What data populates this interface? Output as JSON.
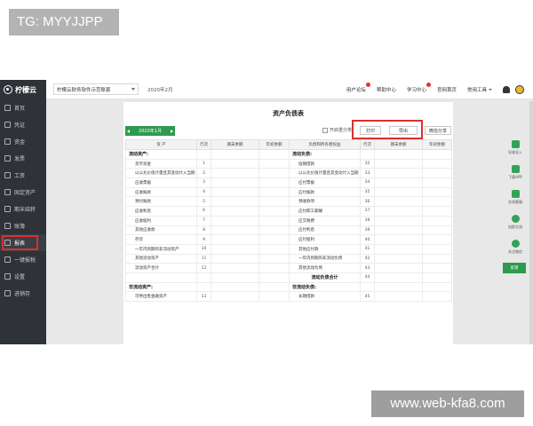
{
  "watermark": {
    "tag": "TG: MYYJJPP",
    "url": "www.web-kfa8.com"
  },
  "app": {
    "logo_text": "柠檬云",
    "sidebar": [
      {
        "label": "首页",
        "icon": "home-icon"
      },
      {
        "label": "凭证",
        "icon": "voucher-icon"
      },
      {
        "label": "资金",
        "icon": "fund-icon"
      },
      {
        "label": "发票",
        "icon": "invoice-icon"
      },
      {
        "label": "工资",
        "icon": "salary-icon"
      },
      {
        "label": "固定资产",
        "icon": "asset-icon"
      },
      {
        "label": "期末结转",
        "icon": "period-close-icon"
      },
      {
        "label": "账簿",
        "icon": "ledger-icon"
      },
      {
        "label": "报表",
        "icon": "report-icon",
        "active": true
      },
      {
        "label": "一键报税",
        "icon": "tax-icon"
      },
      {
        "label": "设置",
        "icon": "settings-icon"
      },
      {
        "label": "进销存",
        "icon": "inventory-icon"
      }
    ],
    "topbar": {
      "company": "柠檬云财务软件示范账套",
      "period": "2020年2月",
      "links": [
        {
          "label": "用户论坛",
          "badge": true
        },
        {
          "label": "帮助中心",
          "badge": false
        },
        {
          "label": "学习中心",
          "badge": true
        },
        {
          "label": "官网首页",
          "badge": false
        },
        {
          "label": "常用工具",
          "badge": false,
          "caret": true
        }
      ]
    },
    "sheet": {
      "title": "资产负债表",
      "period_picker": "2020年1月",
      "reclass_label": "开启重分类",
      "buttons": {
        "print": "打印",
        "export": "导出",
        "wechat": "微信分享"
      },
      "headers": [
        "资 产",
        "行次",
        "期末余额",
        "年初余额",
        "负债和所有者权益",
        "行次",
        "期末余额",
        "年初余额"
      ],
      "rows": [
        {
          "l": "流动资产:",
          "ln": "",
          "lt": "sec",
          "r": "流动负债:",
          "rn": "",
          "rt": "sec"
        },
        {
          "l": "货币资金",
          "ln": "1",
          "lt": "item",
          "r": "短期借款",
          "rn": "32",
          "rt": "item"
        },
        {
          "l": "以公允价值计量且其变动计入当期",
          "ln": "2",
          "lt": "item",
          "r": "以公允价值计量且其变动计入当期",
          "rn": "33",
          "rt": "item"
        },
        {
          "l": "应收票据",
          "ln": "3",
          "lt": "item",
          "r": "应付票据",
          "rn": "34",
          "rt": "item"
        },
        {
          "l": "应收账款",
          "ln": "4",
          "lt": "item",
          "r": "应付账款",
          "rn": "35",
          "rt": "item"
        },
        {
          "l": "预付账款",
          "ln": "5",
          "lt": "item",
          "r": "预收款项",
          "rn": "36",
          "rt": "item"
        },
        {
          "l": "应收利息",
          "ln": "6",
          "lt": "item",
          "r": "应付职工薪酬",
          "rn": "37",
          "rt": "item"
        },
        {
          "l": "应收股利",
          "ln": "7",
          "lt": "item",
          "r": "应交税费",
          "rn": "38",
          "rt": "item"
        },
        {
          "l": "其他应收款",
          "ln": "8",
          "lt": "item",
          "r": "应付利息",
          "rn": "39",
          "rt": "item"
        },
        {
          "l": "存货",
          "ln": "9",
          "lt": "item",
          "r": "应付股利",
          "rn": "40",
          "rt": "item"
        },
        {
          "l": "一年内到期的非流动资产",
          "ln": "10",
          "lt": "item",
          "r": "其他应付款",
          "rn": "41",
          "rt": "item"
        },
        {
          "l": "其他流动资产",
          "ln": "11",
          "lt": "item",
          "r": "一年内到期的非流动负债",
          "rn": "42",
          "rt": "item"
        },
        {
          "l": "流动资产合计",
          "ln": "12",
          "lt": "item",
          "r": "其他流动负债",
          "rn": "43",
          "rt": "item"
        },
        {
          "l": "",
          "ln": "",
          "lt": "item",
          "r": "流动负债合计",
          "rn": "44",
          "rt": "total"
        },
        {
          "l": "非流动资产:",
          "ln": "",
          "lt": "sec",
          "r": "非流动负债:",
          "rn": "",
          "rt": "sec"
        },
        {
          "l": "可供出售金融资产",
          "ln": "13",
          "lt": "item",
          "r": "长期借款",
          "rn": "45",
          "rt": "item"
        }
      ]
    },
    "rightbar": {
      "items": [
        {
          "label": "导账导入",
          "icon": "download-icon"
        },
        {
          "label": "下载APP",
          "icon": "app-download-icon"
        },
        {
          "label": "在线客服",
          "icon": "customer-service-icon"
        },
        {
          "label": "加群交流",
          "icon": "group-chat-icon"
        },
        {
          "label": "关注微信",
          "icon": "wechat-icon"
        }
      ],
      "feedback": "反馈"
    }
  }
}
